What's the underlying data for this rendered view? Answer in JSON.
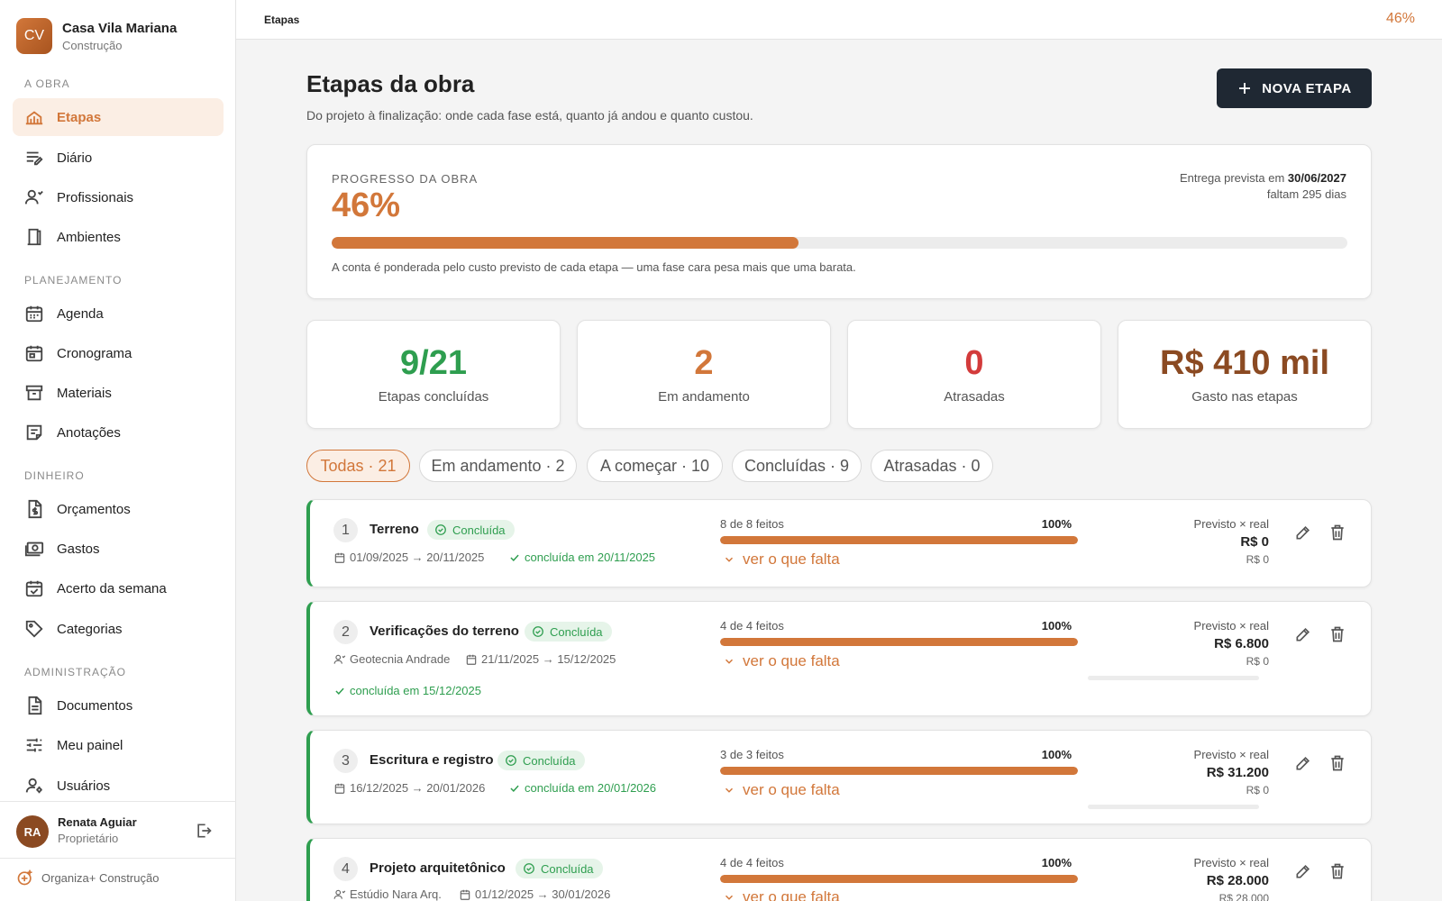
{
  "app": {
    "logo_initials": "CV",
    "project_name": "Casa Vila Mariana",
    "project_type": "Construção",
    "footer_brand": "Organiza+ Construção"
  },
  "sidebar": {
    "sections": [
      {
        "title": "A OBRA",
        "items": [
          {
            "label": "Etapas",
            "icon": "stages-icon",
            "active": true
          },
          {
            "label": "Diário",
            "icon": "journal-icon"
          },
          {
            "label": "Profissionais",
            "icon": "professionals-icon"
          },
          {
            "label": "Ambientes",
            "icon": "rooms-icon"
          }
        ]
      },
      {
        "title": "PLANEJAMENTO",
        "items": [
          {
            "label": "Agenda",
            "icon": "agenda-icon"
          },
          {
            "label": "Cronograma",
            "icon": "schedule-icon"
          },
          {
            "label": "Materiais",
            "icon": "materials-icon"
          },
          {
            "label": "Anotações",
            "icon": "notes-icon"
          }
        ]
      },
      {
        "title": "DINHEIRO",
        "items": [
          {
            "label": "Orçamentos",
            "icon": "quotes-icon"
          },
          {
            "label": "Gastos",
            "icon": "expenses-icon"
          },
          {
            "label": "Acerto da semana",
            "icon": "weekly-settlement-icon"
          },
          {
            "label": "Categorias",
            "icon": "tag-icon"
          }
        ]
      },
      {
        "title": "ADMINISTRAÇÃO",
        "items": [
          {
            "label": "Documentos",
            "icon": "documents-icon"
          },
          {
            "label": "Meu painel",
            "icon": "panel-settings-icon"
          },
          {
            "label": "Usuários",
            "icon": "users-icon"
          }
        ]
      }
    ]
  },
  "user": {
    "initials": "RA",
    "name": "Renata Aguiar",
    "role": "Proprietário"
  },
  "topbar": {
    "breadcrumb": "Etapas",
    "progress_text": "46%"
  },
  "page": {
    "title": "Etapas da obra",
    "subtitle": "Do projeto à finalização: onde cada fase está, quanto já andou e quanto custou.",
    "new_button": "NOVA ETAPA"
  },
  "progress": {
    "label": "PROGRESSO DA OBRA",
    "value_text": "46%",
    "fraction": 0.46,
    "delivery_prefix": "Entrega prevista em",
    "delivery_date": "30/06/2027",
    "remaining": "faltam 295 dias",
    "note": "A conta é ponderada pelo custo previsto de cada etapa — uma fase cara pesa mais que uma barata."
  },
  "stats": [
    {
      "value": "9/21",
      "label": "Etapas concluídas",
      "color": "#2e9e4f"
    },
    {
      "value": "2",
      "label": "Em andamento",
      "color": "#d2773a"
    },
    {
      "value": "0",
      "label": "Atrasadas",
      "color": "#d33b3b"
    },
    {
      "value": "R$ 410 mil",
      "label": "Gasto nas etapas",
      "color": "#8b4a22"
    }
  ],
  "filters": [
    {
      "label": "Todas · 21",
      "active": true
    },
    {
      "label": "Em andamento · 2"
    },
    {
      "label": "A começar · 10"
    },
    {
      "label": "Concluídas · 9"
    },
    {
      "label": "Atrasadas · 0"
    }
  ],
  "common": {
    "status_done": "Concluída",
    "see_missing": "ver o que falta",
    "cost_label": "Previsto × real",
    "accent": "#d2773a",
    "success": "#2e9e4f"
  },
  "stages": [
    {
      "num": "1",
      "title": "Terreno",
      "dates": "01/09/2025 → 20/11/2025",
      "done_text": "concluída em 20/11/2025",
      "count": "8 de 8 feitos",
      "pct": "100%",
      "fraction": 1.0,
      "planned": "R$ 0",
      "real": "R$ 0"
    },
    {
      "num": "2",
      "title": "Verificações do terreno",
      "professional": "Geotecnia Andrade",
      "dates": "21/11/2025 → 15/12/2025",
      "done_text": "concluída em 15/12/2025",
      "count": "4 de 4 feitos",
      "pct": "100%",
      "fraction": 1.0,
      "planned": "R$ 6.800",
      "real": "R$ 0"
    },
    {
      "num": "3",
      "title": "Escritura e registro",
      "dates": "16/12/2025 → 20/01/2026",
      "done_text": "concluída em 20/01/2026",
      "count": "3 de 3 feitos",
      "pct": "100%",
      "fraction": 1.0,
      "planned": "R$ 31.200",
      "real": "R$ 0"
    },
    {
      "num": "4",
      "title": "Projeto arquitetônico",
      "professional": "Estúdio Nara Arq.",
      "dates": "01/12/2025 → 30/01/2026",
      "count": "4 de 4 feitos",
      "pct": "100%",
      "fraction": 1.0,
      "planned": "R$ 28.000",
      "real": "R$ 28.000"
    }
  ]
}
